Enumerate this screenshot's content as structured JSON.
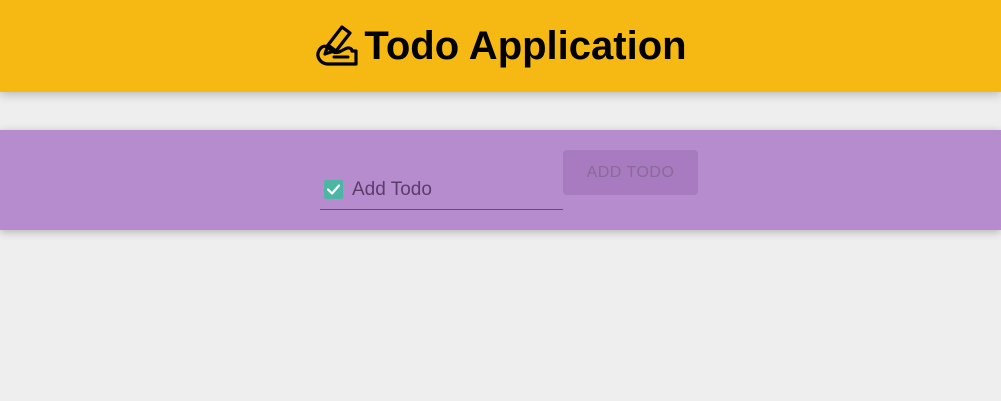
{
  "header": {
    "title": "Todo Application",
    "icon": "writing-hand-icon"
  },
  "todo_form": {
    "input_placeholder": "Add Todo",
    "input_value": "",
    "checkbox_icon": "checkbox-checked-icon",
    "checkbox_checked": true,
    "add_button_label": "ADD TODO",
    "add_button_disabled": true
  },
  "colors": {
    "header_bg": "#f6b914",
    "panel_bg": "#b78ccf",
    "page_bg": "#eeeeee",
    "checkbox": "#4db6a3"
  }
}
